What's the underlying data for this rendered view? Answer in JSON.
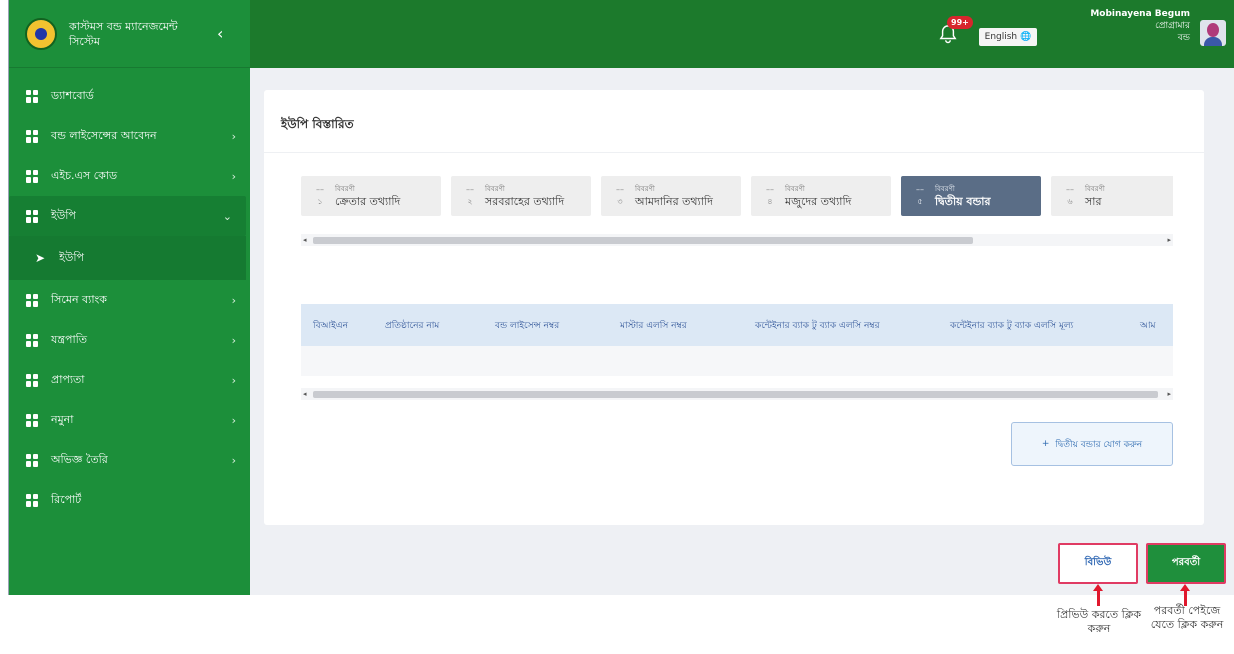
{
  "brand": {
    "title": "কাস্টমস বন্ড ম্যানেজমেন্ট সিস্টেম",
    "collapse_icon": "chevron-left-icon"
  },
  "sidebar": {
    "items": [
      {
        "label": "ড্যাশবোর্ড",
        "has_children": false
      },
      {
        "label": "বন্ড লাইসেন্সের আবেদন",
        "has_children": true
      },
      {
        "label": "এইচ.এস কোড",
        "has_children": true
      },
      {
        "label": "ইউপি",
        "has_children": true,
        "expanded": true
      },
      {
        "label": "ইউপি",
        "sub": true
      },
      {
        "label": "সিমেন ব্যাংক",
        "has_children": true
      },
      {
        "label": "যন্ত্রপাতি",
        "has_children": true
      },
      {
        "label": "প্রাপ্যতা",
        "has_children": true
      },
      {
        "label": "নমুনা",
        "has_children": true
      },
      {
        "label": "অভিজ্ঞ তৈরি",
        "has_children": true
      },
      {
        "label": "রিপোর্ট",
        "has_children": false
      }
    ]
  },
  "header": {
    "notification_badge": "99+",
    "language": "English",
    "user_name": "Mobinayena Begum",
    "user_role": "প্রোগ্রামার",
    "user_role2": "বন্ড"
  },
  "card": {
    "title": "ইউপি বিস্তারিত",
    "steps": [
      {
        "num": "১",
        "small": "বিবরণী",
        "label": "ক্রেতার তথ্যাদি",
        "active": false
      },
      {
        "num": "২",
        "small": "বিবরণী",
        "label": "সরবরাহের তথ্যাদি",
        "active": false
      },
      {
        "num": "৩",
        "small": "বিবরণী",
        "label": "আমদানির তথ্যাদি",
        "active": false
      },
      {
        "num": "৪",
        "small": "বিবরণী",
        "label": "মজুদের তথ্যাদি",
        "active": false
      },
      {
        "num": "৫",
        "small": "বিবরণী",
        "label": "দ্বিতীয় বন্ডার",
        "active": true
      },
      {
        "num": "৬",
        "small": "বিবরণী",
        "label": "সার",
        "active": false
      }
    ],
    "table_headers": [
      "বিআইএন",
      "প্রতিষ্ঠানের নাম",
      "বন্ড লাইসেন্স নম্বর",
      "মাস্টার এলসি নম্বর",
      "কন্টেইনার ব্যাক টু ব্যাক এলসি নম্বর",
      "কন্টেইনার ব্যাক টু ব্যাক এলসি মূল্য",
      "আম"
    ],
    "add_button": "দ্বিতীয় বন্ডার যোগ করুন"
  },
  "footer": {
    "prev_label": "বিভিউ",
    "next_label": "পরবর্তী"
  },
  "annotations": {
    "preview_note": "প্রিভিউ করতে ক্লিক করুন",
    "next_note": "পরবর্তী পেইজে যেতে ক্লিক করুন"
  }
}
